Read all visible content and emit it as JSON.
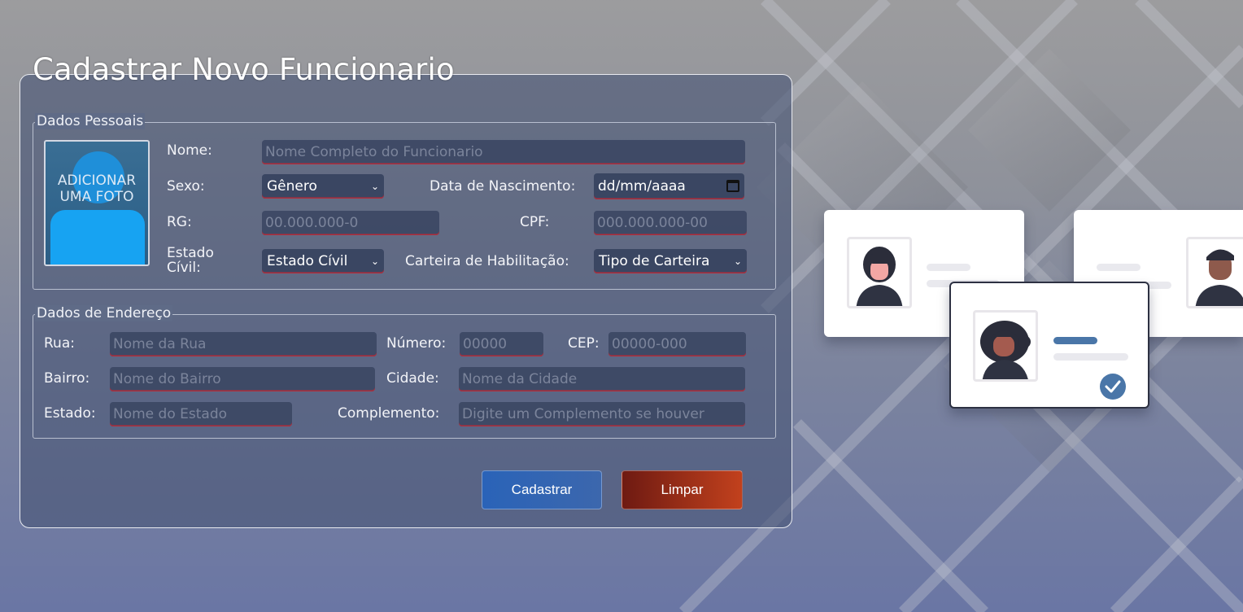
{
  "form": {
    "title": "Cadastrar Novo Funcionario",
    "personal": {
      "legend": "Dados Pessoais",
      "photo_label": "Adicionar uma foto",
      "nome_label": "Nome:",
      "nome_placeholder": "Nome Completo do Funcionario",
      "sexo_label": "Sexo:",
      "sexo_value": "Gênero",
      "nascimento_label": "Data de Nascimento:",
      "nascimento_value": "dd/mm/aaaa",
      "rg_label": "RG:",
      "rg_placeholder": "00.000.000-0",
      "cpf_label": "CPF:",
      "cpf_placeholder": "000.000.000-00",
      "estado_civil_label": "Estado Cívil:",
      "estado_civil_value": "Estado Cívil",
      "habilitacao_label": "Carteira de Habilitação:",
      "habilitacao_value": "Tipo de Carteira"
    },
    "address": {
      "legend": "Dados de Endereço",
      "rua_label": "Rua:",
      "rua_placeholder": "Nome da Rua",
      "numero_label": "Número:",
      "numero_placeholder": "00000",
      "cep_label": "CEP:",
      "cep_placeholder": "00000-000",
      "bairro_label": "Bairro:",
      "bairro_placeholder": "Nome do Bairro",
      "cidade_label": "Cidade:",
      "cidade_placeholder": "Nome da Cidade",
      "estado_label": "Estado:",
      "estado_placeholder": "Nome do Estado",
      "complemento_label": "Complemento:",
      "complemento_placeholder": "Digite um Complemento se houver"
    },
    "buttons": {
      "submit": "Cadastrar",
      "clear": "Limpar"
    }
  },
  "illustration": {
    "accent": "#4a76a8",
    "check_icon": "check-icon"
  }
}
